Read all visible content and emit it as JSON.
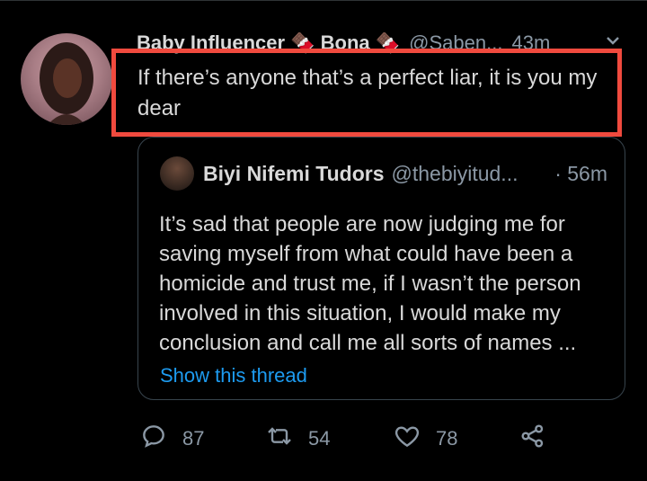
{
  "tweet": {
    "author_name": "Baby Influencer 🍫 Bona 🍫",
    "author_handle": "@Saben...",
    "time": "43m",
    "text": "If there’s anyone that’s a perfect liar, it is you my dear"
  },
  "quoted_tweet": {
    "author_name": "Biyi Nifemi Tudors",
    "author_handle": "@thebiyitud...",
    "time": "· 56m",
    "text": "It’s sad that people are now judging me for saving myself from what could have been a homicide and trust me, if I wasn’t the person involved in this situation, I would make my conclusion and call me all sorts of names ...",
    "show_thread": "Show this thread"
  },
  "actions": {
    "reply_count": "87",
    "retweet_count": "54",
    "like_count": "78"
  },
  "colors": {
    "background": "#000000",
    "text": "#d9d9d9",
    "muted": "#8b98a5",
    "link": "#1d9bf0",
    "highlight": "#f04a3e"
  },
  "icons": {
    "more": "chevron-down-icon",
    "reply": "reply-icon",
    "retweet": "retweet-icon",
    "like": "heart-icon",
    "share": "share-icon"
  }
}
